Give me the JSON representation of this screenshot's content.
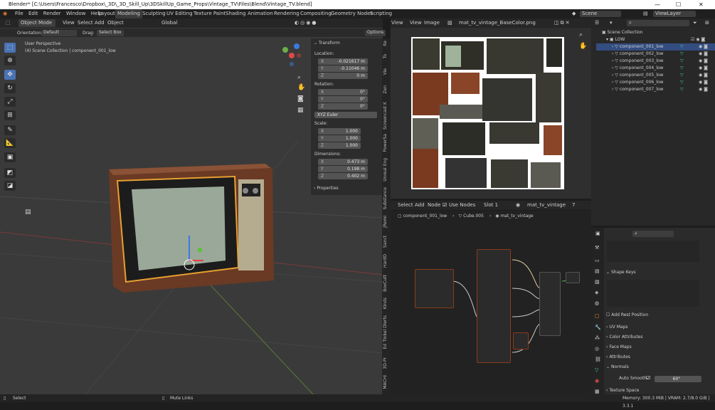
{
  "title": "Blender* [C:\\Users\\Francesco\\Dropbox\\_3D\\_3D_Skill_Up\\3DSkillUp_Game_Props\\Vintage_TV\\Files\\Blend\\Vintage_TV.blend]",
  "window_controls": {
    "minimize": "—",
    "maximize": "☐",
    "close": "✕"
  },
  "menu": [
    "File",
    "Edit",
    "Render",
    "Window",
    "Help"
  ],
  "workspaces": [
    "Layout",
    "Modeling",
    "Sculpting",
    "UV Editing",
    "Texture Paint",
    "Shading",
    "Animation",
    "Rendering",
    "Compositing",
    "Geometry Nodes",
    "Scripting"
  ],
  "active_workspace": "Modeling",
  "scene": "Scene",
  "view_layer": "ViewLayer",
  "viewport": {
    "mode": "Object Mode",
    "menus": [
      "View",
      "Select",
      "Add",
      "Object"
    ],
    "transform_orient": "Global",
    "orientation_label": "Orientation:",
    "orientation_value": "Default",
    "drag_label": "Drag:",
    "drag_value": "Select Box",
    "options": "Options",
    "perspective": "User Perspective",
    "collection_info": "(4) Scene Collection | component_001_low"
  },
  "transform": {
    "header": "Transform",
    "location_label": "Location:",
    "location": [
      {
        "ax": "X",
        "v": "-0.021617 m"
      },
      {
        "ax": "Y",
        "v": "-0.11046 m"
      },
      {
        "ax": "Z",
        "v": "0 m"
      }
    ],
    "rotation_label": "Rotation:",
    "rotation": [
      {
        "ax": "X",
        "v": "0°"
      },
      {
        "ax": "Y",
        "v": "0°"
      },
      {
        "ax": "Z",
        "v": "0°"
      }
    ],
    "rotation_mode": "XYZ Euler",
    "scale_label": "Scale:",
    "scale": [
      {
        "ax": "X",
        "v": "1.000"
      },
      {
        "ax": "Y",
        "v": "1.000"
      },
      {
        "ax": "Z",
        "v": "1.000"
      }
    ],
    "dimensions_label": "Dimensions:",
    "dimensions": [
      {
        "ax": "X",
        "v": "0.473 m"
      },
      {
        "ax": "Y",
        "v": "0.198 m"
      },
      {
        "ax": "Z",
        "v": "0.402 m"
      }
    ],
    "properties": "Properties"
  },
  "side_tabs": [
    "Ite",
    "To",
    "Vie",
    "Zen",
    "Screencast K",
    "PowerSa",
    "Unreal Eng",
    "Substance",
    "JRemi",
    "Sanct",
    "HardO",
    "BoxCutt",
    "Kinds",
    "Tinkel Dlerts",
    "Ed",
    "3D-Pr",
    "MACHI"
  ],
  "image_editor": {
    "menus": [
      "View",
      "View",
      "Image"
    ],
    "image_name": "mat_tv_vintage_BaseColor.png"
  },
  "node_editor": {
    "menus": [
      "Select",
      "Add",
      "Node"
    ],
    "use_nodes": "Use Nodes",
    "slot": "Slot 1",
    "material": "mat_tv_vintage",
    "material_users": "7",
    "breadcrumb": [
      "component_001_low",
      "Cube.005",
      "mat_tv_vintage"
    ]
  },
  "outliner": {
    "root": "Scene Collection",
    "collection": "LOW",
    "items": [
      "component_001_low",
      "component_002_low",
      "component_003_low",
      "component_004_low",
      "component_005_low",
      "component_006_low",
      "component_007_low"
    ]
  },
  "properties": {
    "shape_keys": "Shape Keys",
    "add_rest_position": "Add Rest Position",
    "sections": [
      "UV Maps",
      "Color Attributes",
      "Face Maps",
      "Attributes",
      "Normals"
    ],
    "auto_smooth": "Auto Smooth",
    "auto_smooth_angle": "60°",
    "texture_space": "Texture Space"
  },
  "status": {
    "left": "Select",
    "middle": "Mute Links",
    "right": "Memory: 300.3 MiB | VRAM: 2.7/8.0 GiB | 3.3.1"
  },
  "colors": {
    "accent": "#4a73b5",
    "selected_row": "#334d80",
    "node_frame": "#8a3a1c",
    "object_outline": "#f0a030"
  }
}
